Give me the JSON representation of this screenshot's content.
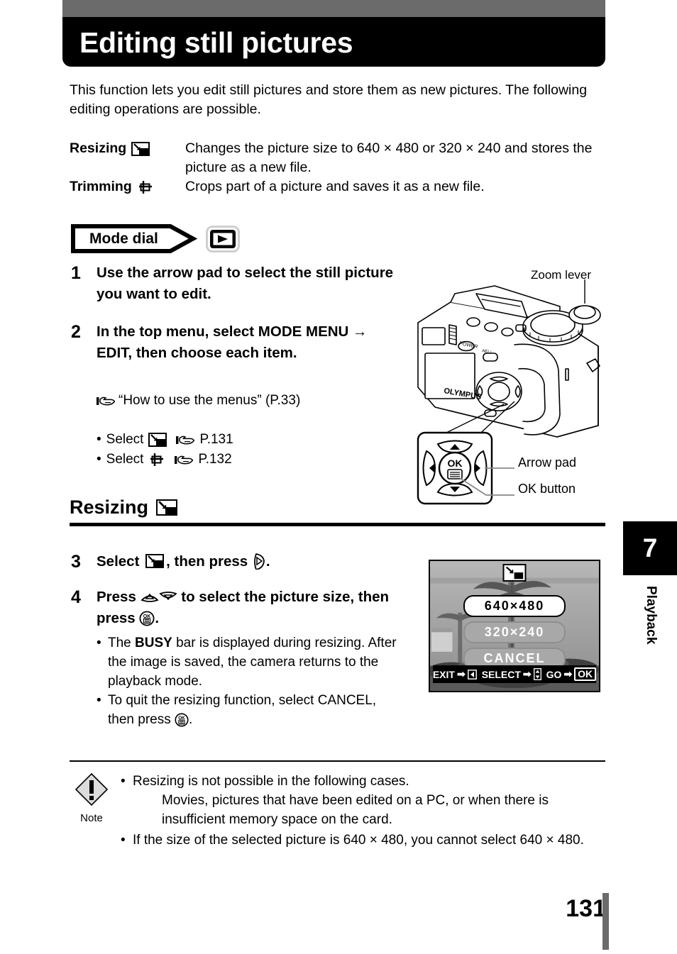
{
  "header": {
    "title": "Editing still pictures",
    "bar_color": "#6b6b6b"
  },
  "intro": "This function lets you edit still pictures and store them as new pictures. The following editing operations are possible.",
  "definitions": [
    {
      "term": "Resizing",
      "icon": "resize-icon",
      "description": "Changes the picture size to 640 × 480 or 320 × 240 and stores the picture as a new file."
    },
    {
      "term": "Trimming",
      "icon": "trim-icon",
      "description": "Crops part of a picture and saves it as a new file."
    }
  ],
  "mode_dial": {
    "label": "Mode dial",
    "icon": "playback-icon"
  },
  "steps": [
    {
      "number": "1",
      "text": "Use the arrow pad to select the still picture you want to edit."
    },
    {
      "number": "2",
      "text": "In the top menu, select MODE MENU → EDIT, then choose each item."
    }
  ],
  "reference": {
    "icon": "pointing-hand-icon",
    "text": "“How to use the menus” (P.33)"
  },
  "bullets": [
    {
      "prefix": "Select",
      "icon": "resize-icon",
      "ref_icon": "pointing-hand-icon",
      "page": "P.131"
    },
    {
      "prefix": "Select",
      "icon": "trim-icon",
      "ref_icon": "pointing-hand-icon",
      "page": "P.132"
    }
  ],
  "section": {
    "title": "Resizing",
    "icon": "resize-icon"
  },
  "steps2": [
    {
      "number": "3",
      "text_before": "Select",
      "icon": "resize-icon",
      "text_after": ", then press",
      "end_icon": "arrow-right-pad-icon",
      "period": "."
    },
    {
      "number": "4",
      "text_before": "Press",
      "icons": "up-down-pad-icon",
      "text_mid": "to select the picture size, then press",
      "end_icon": "ok-button-icon",
      "period": "."
    }
  ],
  "step4_notes": [
    "The BUSY bar is displayed during resizing. After the image is saved, the camera returns to the playback mode.",
    "To quit the resizing function, select CANCEL, then press "
  ],
  "step4_note1_bold": "BUSY",
  "lcd": {
    "title_icon": "resize-icon",
    "options": [
      {
        "label": "640×480",
        "selected": true
      },
      {
        "label": "320×240",
        "selected": false
      },
      {
        "label": "CANCEL",
        "selected": false
      }
    ],
    "status_bar": [
      {
        "label": "EXIT",
        "arrow": "➡",
        "icon": "left-pad-icon"
      },
      {
        "label": "SELECT",
        "arrow": "➡",
        "icon": "up-down-pad-icon"
      },
      {
        "label": "GO",
        "arrow": "➡",
        "icon": "ok-box-icon",
        "icon_text": "OK"
      }
    ]
  },
  "camera": {
    "brand": "OLYMPUS",
    "labels": [
      {
        "name": "zoom-lever",
        "text": "Zoom lever"
      },
      {
        "name": "arrow-pad",
        "text": "Arrow pad"
      },
      {
        "name": "ok-button",
        "text": "OK button"
      }
    ],
    "pad_center_text": "OK"
  },
  "note": {
    "icon": "warning-diamond-icon",
    "label": "Note",
    "items": [
      {
        "text": "Resizing is not possible in the following cases.",
        "sub": "Movies, pictures that have been edited on a PC, or when there is insufficient memory space on the card."
      },
      {
        "text": "If the size of the selected picture is 640 × 480, you cannot select 640 × 480.",
        "sub": ""
      }
    ]
  },
  "chapter_tab": {
    "number": "7",
    "label": "Playback"
  },
  "footer": {
    "page_number": "131"
  }
}
